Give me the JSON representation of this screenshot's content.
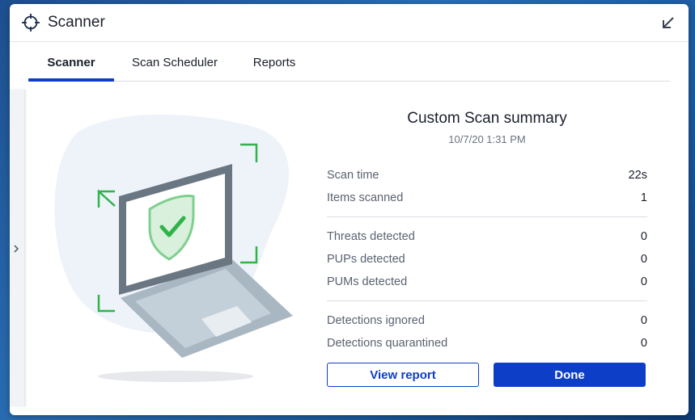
{
  "window": {
    "title": "Scanner"
  },
  "tabs": [
    {
      "label": "Scanner",
      "active": true
    },
    {
      "label": "Scan Scheduler",
      "active": false
    },
    {
      "label": "Reports",
      "active": false
    }
  ],
  "summary": {
    "title": "Custom Scan summary",
    "date": "10/7/20 1:31 PM",
    "groups": [
      [
        {
          "label": "Scan time",
          "value": "22s"
        },
        {
          "label": "Items scanned",
          "value": "1"
        }
      ],
      [
        {
          "label": "Threats detected",
          "value": "0"
        },
        {
          "label": "PUPs detected",
          "value": "0"
        },
        {
          "label": "PUMs detected",
          "value": "0"
        }
      ],
      [
        {
          "label": "Detections ignored",
          "value": "0"
        },
        {
          "label": "Detections quarantined",
          "value": "0"
        }
      ]
    ]
  },
  "buttons": {
    "view_report": "View report",
    "done": "Done"
  },
  "icons": {
    "title": "crosshair-icon",
    "collapse": "arrow-down-left-icon",
    "side_toggle": "chevron-right-icon",
    "shield": "shield-check-icon"
  },
  "colors": {
    "accent": "#0d3ec7",
    "success": "#2fb34a"
  }
}
